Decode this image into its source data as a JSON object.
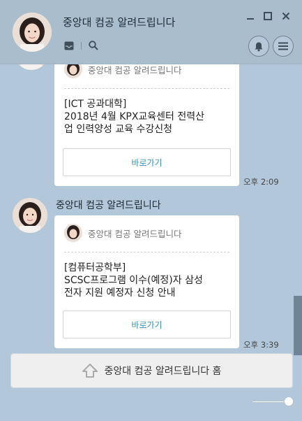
{
  "header": {
    "title": "중앙대 컴공 알려드립니다"
  },
  "messages": [
    {
      "sender": "",
      "brand": "중앙대 컴공 알려드립니다",
      "body": "[ICT 공과대학]\n 2018년 4월 KPX교육센터 전력산\n업 인력양성 교육 수강신청",
      "button": "바로가기",
      "time": "오후 2:09"
    },
    {
      "sender": "중앙대 컴공 알려드립니다",
      "brand": "중앙대 컴공 알려드립니다",
      "body": "[컴퓨터공학부]\nSCSC프로그램 이수(예정)자 삼성\n전자 지원 예정자 신청 안내",
      "button": "바로가기",
      "time": "오후 3:39"
    }
  ],
  "home_button": {
    "label": "중앙대 컴공 알려드립니다 홈"
  },
  "colors": {
    "background": "#b2c7d9",
    "link": "#3a97b8"
  }
}
